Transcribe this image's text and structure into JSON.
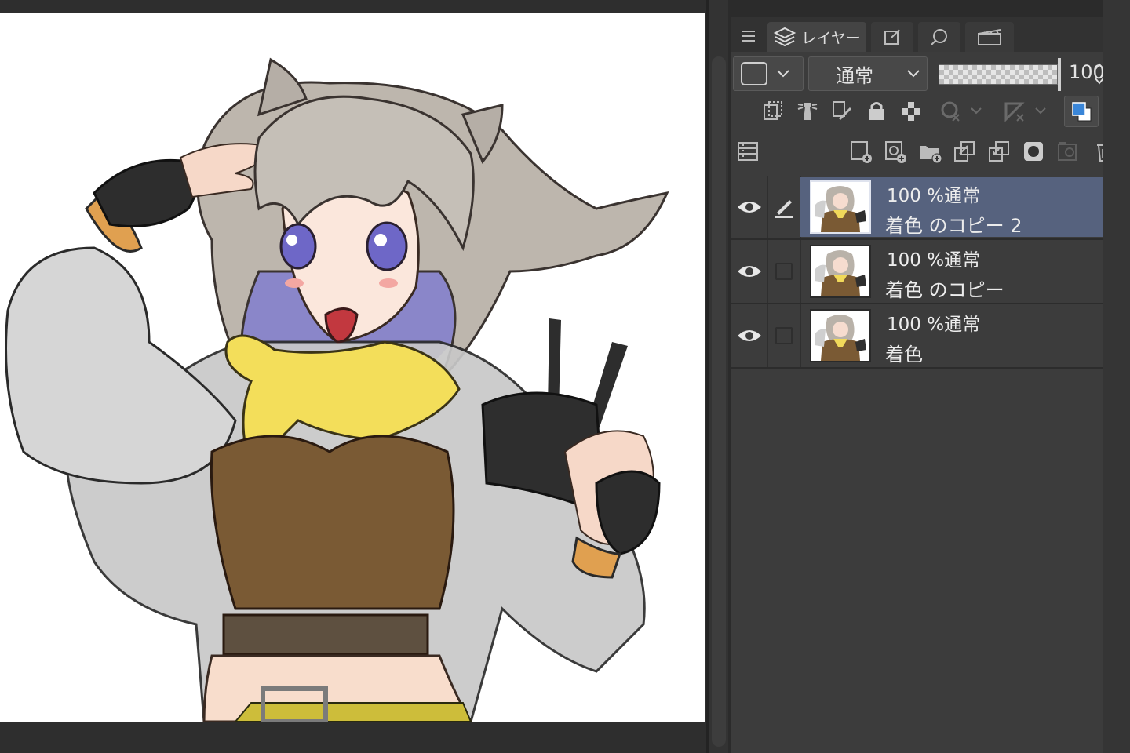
{
  "panel": {
    "tabs": [
      {
        "label": "レイヤー",
        "icon": "layers-icon"
      },
      {
        "label": "",
        "icon": "property-icon"
      },
      {
        "label": "",
        "icon": "search-layer-icon"
      },
      {
        "label": "",
        "icon": "animation-icon"
      }
    ],
    "blend_mode": "通常",
    "opacity": "100",
    "opacity_fraction": 1.0,
    "accent_color": "#3a86d8",
    "selected_color": "#56627e"
  },
  "layers": [
    {
      "mode": "100 %通常",
      "name": "着色 のコピー 2",
      "selected": true,
      "visible": true
    },
    {
      "mode": "100 %通常",
      "name": "着色 のコピー",
      "selected": false,
      "visible": true
    },
    {
      "mode": "100 %通常",
      "name": "着色",
      "selected": false,
      "visible": true
    }
  ]
}
